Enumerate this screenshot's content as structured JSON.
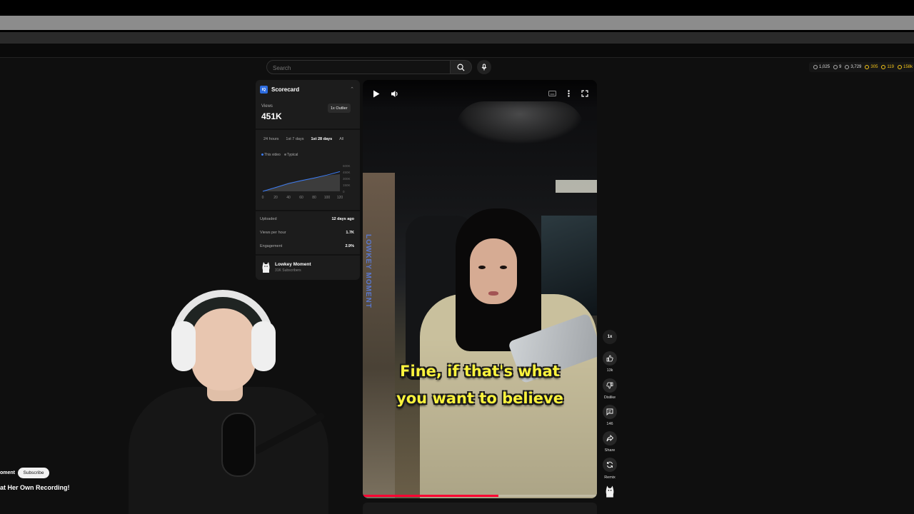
{
  "search": {
    "placeholder": "Search"
  },
  "stats": [
    {
      "icon": "clock-icon",
      "value": "1,025"
    },
    {
      "icon": "eye-icon",
      "value": "9"
    },
    {
      "icon": "eye-icon",
      "value": "3,729"
    },
    {
      "icon": "user-icon",
      "value": "305",
      "color": "#f5c518"
    },
    {
      "icon": "clock-icon",
      "value": "119",
      "color": "#f5c518"
    },
    {
      "icon": "bolt-icon",
      "value": "158k",
      "color": "#f5c518"
    }
  ],
  "scorecard": {
    "logo": "IQ",
    "title": "Scorecard",
    "views_label": "Views",
    "views_value": "451K",
    "outlier_badge": "1x Outlier",
    "tabs": [
      "24 hours",
      "1st 7 days",
      "1st 28 days",
      "All"
    ],
    "active_tab": "1st 28 days",
    "legend": {
      "this_video": "This video",
      "typical": "Typical"
    },
    "colors": {
      "this_video": "#3b7cf6",
      "typical": "#6b6b6b"
    },
    "rows": [
      {
        "label": "Uploaded",
        "value": "12 days ago"
      },
      {
        "label": "Views per hour",
        "value": "1.7K"
      },
      {
        "label": "Engagement",
        "value": "2.9%"
      }
    ],
    "channel": {
      "name": "Lowkey Moment",
      "subscribers": "31K Subscribers"
    }
  },
  "chart_data": {
    "type": "area",
    "x": [
      0,
      20,
      40,
      60,
      80,
      100,
      120
    ],
    "xlim": [
      0,
      120
    ],
    "ylim": [
      0,
      600
    ],
    "y_tick_labels": [
      "600K",
      "450K",
      "300K",
      "150K",
      "0"
    ],
    "series": [
      {
        "name": "This video",
        "values": [
          0,
          90,
          180,
          250,
          310,
          380,
          460
        ]
      },
      {
        "name": "Typical",
        "values": [
          0,
          100,
          200,
          260,
          320,
          370,
          400
        ]
      }
    ],
    "legend_position": "top-left"
  },
  "video": {
    "watermark": "LOWKEY MOMENT",
    "caption_line1": "Fine, if that's what",
    "caption_line2": "you want to believe",
    "progress": 0.58
  },
  "rail": {
    "speed": "1x",
    "like_count": "13k",
    "dislike_label": "Dislike",
    "comment_count": "146",
    "share_label": "Share",
    "remix_label": "Remix"
  },
  "overlay": {
    "channel_partial": "oment",
    "subscribe_label": "Subscribe",
    "title_partial": "at Her Own Recording!"
  }
}
